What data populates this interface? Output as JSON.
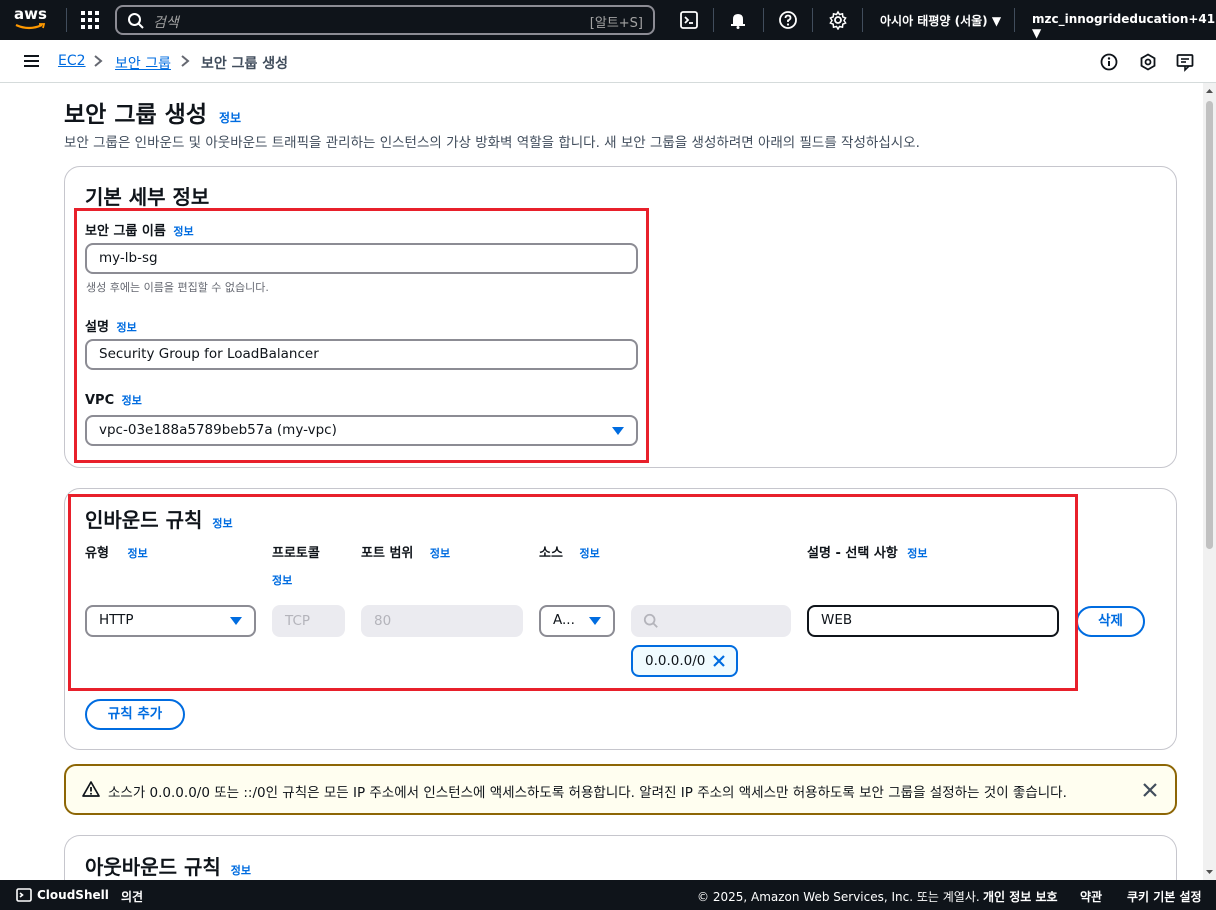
{
  "topnav": {
    "logo": "aws",
    "search_placeholder": "검색",
    "search_shortcut": "[알트+S]",
    "region": "아시아 태평양 (서울)",
    "account": "mzc_innogrideducation+41"
  },
  "breadcrumb": {
    "item1": "EC2",
    "item2": "보안 그룹",
    "current": "보안 그룹 생성"
  },
  "page": {
    "title": "보안 그룹 생성",
    "info": "정보",
    "description": "보안 그룹은 인바운드 및 아웃바운드 트래픽을 관리하는 인스턴스의 가상 방화벽 역할을 합니다. 새 보안 그룹을 생성하려면 아래의 필드를 작성하십시오."
  },
  "basic": {
    "title": "기본 세부 정보",
    "name_label": "보안 그룹 이름",
    "name_value": "my-lb-sg",
    "name_hint": "생성 후에는 이름을 편집할 수 없습니다.",
    "desc_label": "설명",
    "desc_value": "Security Group for LoadBalancer",
    "vpc_label": "VPC",
    "vpc_value": "vpc-03e188a5789beb57a (my-vpc)"
  },
  "inbound": {
    "title": "인바운드 규칙",
    "col_type": "유형",
    "col_protocol": "프로토콜",
    "col_port": "포트 범위",
    "col_source": "소스",
    "col_desc": "설명 - 선택 사항",
    "type_value": "HTTP",
    "protocol_value": "TCP",
    "port_value": "80",
    "source_value": "A...",
    "cidr_token": "0.0.0.0/0",
    "desc_value": "WEB",
    "delete_btn": "삭제",
    "add_rule_btn": "규칙 추가"
  },
  "alert": {
    "text": "소스가 0.0.0.0/0 또는 ::/0인 규칙은 모든 IP 주소에서 인스턴스에 액세스하도록 허용합니다. 알려진 IP 주소의 액세스만 허용하도록 보안 그룹을 설정하는 것이 좋습니다."
  },
  "outbound": {
    "title": "아웃바운드 규칙"
  },
  "footer": {
    "cloudshell": "CloudShell",
    "feedback": "의견",
    "copyright": "© 2025, Amazon Web Services, Inc. 또는 계열사.",
    "privacy": "개인 정보 보호",
    "terms": "약관",
    "cookies": "쿠키 기본 설정"
  },
  "colors": {
    "nav_bg": "#0f141a",
    "link_blue": "#006ce0",
    "highlight_red": "#e8202b",
    "warning_border": "#8d6605"
  }
}
